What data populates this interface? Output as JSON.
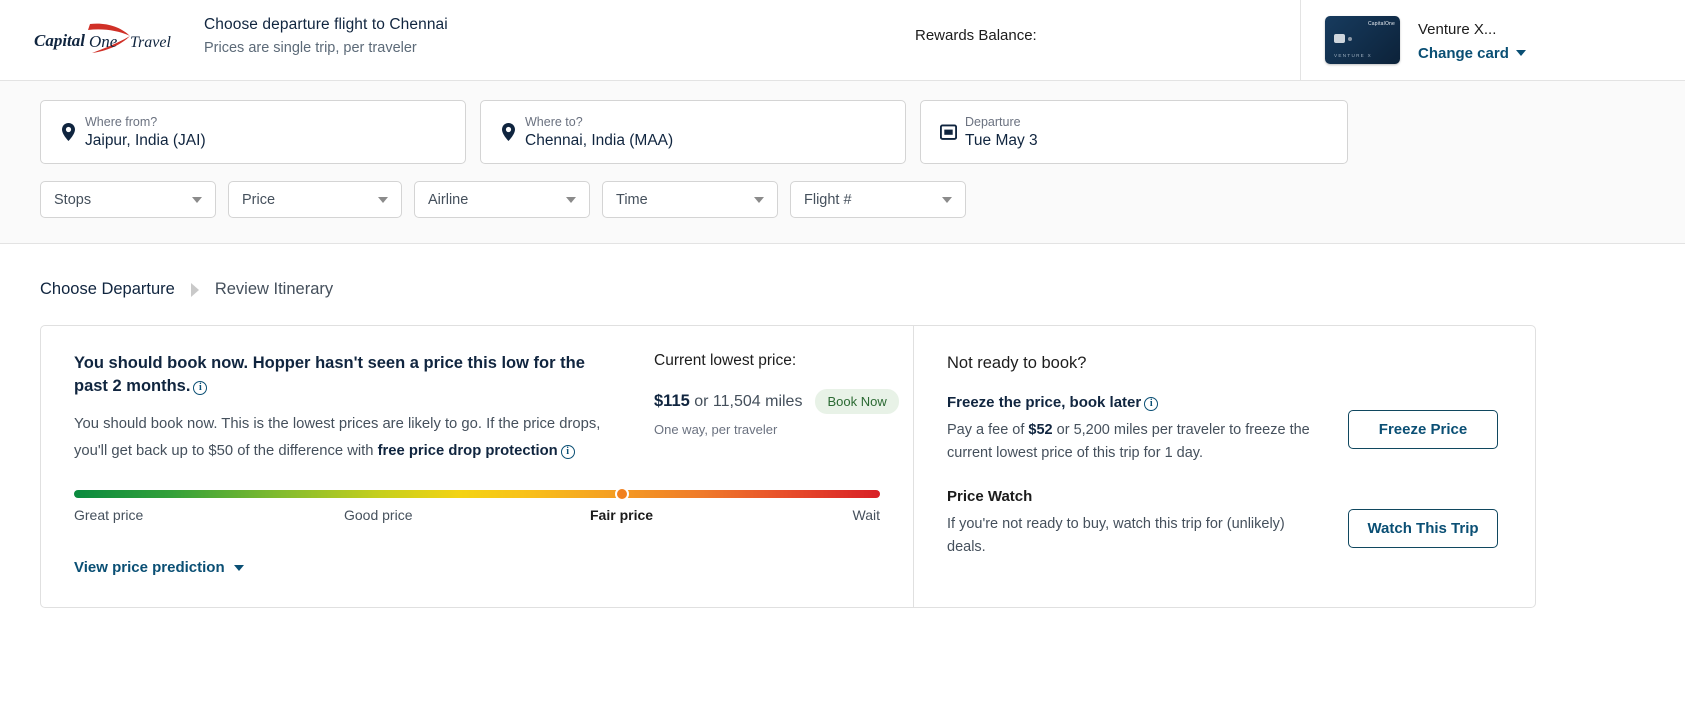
{
  "header": {
    "logo_text": "CapitalOne Travel",
    "title": "Choose departure flight to Chennai",
    "subtitle": "Prices are single trip, per traveler",
    "rewards_label": "Rewards Balance:",
    "card_name": "Venture X...",
    "change_card_label": "Change card"
  },
  "search": {
    "from": {
      "label": "Where from?",
      "value": "Jaipur, India (JAI)"
    },
    "to": {
      "label": "Where to?",
      "value": "Chennai, India (MAA)"
    },
    "departure": {
      "label": "Departure",
      "value": "Tue May 3"
    },
    "filters": [
      {
        "label": "Stops"
      },
      {
        "label": "Price"
      },
      {
        "label": "Airline"
      },
      {
        "label": "Time"
      },
      {
        "label": "Flight #"
      }
    ]
  },
  "breadcrumb": {
    "current": "Choose Departure",
    "next": "Review Itinerary"
  },
  "prediction": {
    "heading": "You should book now. Hopper hasn't seen a price this low for the past 2 months.",
    "body_1": "You should book now. This is the lowest prices are likely to go. If the price drops, you'll get back up to $50 of the difference with ",
    "body_bold": "free price drop protection",
    "view_link": "View price prediction",
    "gauge": {
      "labels": [
        "Great price",
        "Good price",
        "Fair price",
        "Wait"
      ],
      "active_label": "Fair price",
      "marker_percent": 68,
      "colors": [
        "#0a8a3f",
        "#c6cf1d",
        "#f4d313",
        "#f1811f",
        "#d81f26"
      ]
    }
  },
  "lowest_price": {
    "title": "Current lowest price:",
    "amount": "$115",
    "amount_suffix": " or 11,504 miles",
    "badge": "Book Now",
    "sub": "One way, per traveler"
  },
  "not_ready": {
    "title": "Not ready to book?",
    "freeze_title": "Freeze the price, book later",
    "freeze_text_1": "Pay a fee of ",
    "freeze_fee": "$52",
    "freeze_text_2": " or 5,200 miles per traveler to freeze the current lowest price of this trip for 1 day.",
    "freeze_button": "Freeze Price",
    "watch_title": "Price Watch",
    "watch_text": "If you're not ready to buy, watch this trip for (unlikely) deals.",
    "watch_button": "Watch This Trip"
  }
}
